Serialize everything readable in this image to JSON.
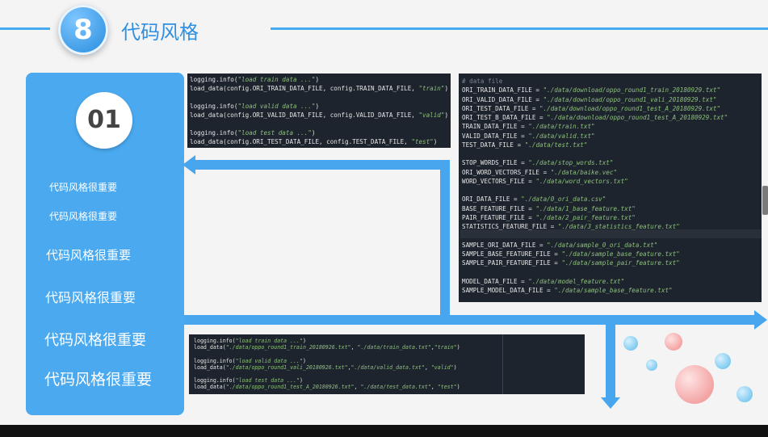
{
  "header": {
    "number": "8",
    "title": "代码风格"
  },
  "panel": {
    "badge": "01",
    "lines": [
      "代码风格很重要",
      "代码风格很重要",
      "代码风格很重要",
      "代码风格很重要",
      "代码风格很重要",
      "代码风格很重要"
    ]
  },
  "code_top": [
    "logging.info(\"load train data ...\")",
    "load_data(config.ORI_TRAIN_DATA_FILE, config.TRAIN_DATA_FILE, \"train\")",
    "",
    "logging.info(\"load valid data ...\")",
    "load_data(config.ORI_VALID_DATA_FILE, config.VALID_DATA_FILE, \"valid\")",
    "",
    "logging.info(\"load test data ...\")",
    "load_data(config.ORI_TEST_DATA_FILE, config.TEST_DATA_FILE, \"test\")"
  ],
  "code_right": [
    "# data file",
    "ORI_TRAIN_DATA_FILE = \"./data/download/oppo_round1_train_20180929.txt\"",
    "ORI_VALID_DATA_FILE = \"./data/download/oppo_round1_vali_20180929.txt\"",
    "ORI_TEST_DATA_FILE = \"./data/download/oppo_round1_test_A_20180929.txt\"",
    "ORI_TEST_B_DATA_FILE = \"./data/download/oppo_round1_test_A_20180929.txt\"",
    "TRAIN_DATA_FILE = \"./data/train.txt\"",
    "VALID_DATA_FILE = \"./data/valid.txt\"",
    "TEST_DATA_FILE = \"./data/test.txt\"",
    "",
    "STOP_WORDS_FILE = \"./data/stop_words.txt\"",
    "ORI_WORD_VECTORS_FILE = \"./data/baike.vec\"",
    "WORD_VECTORS_FILE = \"./data/word_vectors.txt\"",
    "",
    "ORI_DATA_FILE = \"./data/0_ori_data.csv\"",
    "BASE_FEATURE_FILE = \"./data/1_base_feature.txt\"",
    "PAIR_FEATURE_FILE = \"./data/2_pair_feature.txt\"",
    "STATISTICS_FEATURE_FILE = \"./data/3_statistics_feature.txt\"",
    "",
    "SAMPLE_ORI_DATA_FILE = \"./data/sample_0_ori_data.txt\"",
    "SAMPLE_BASE_FEATURE_FILE = \"./data/sample_base_feature.txt\"",
    "SAMPLE_PAIR_FEATURE_FILE = \"./data/sample_pair_feature.txt\"",
    "",
    "MODEL_DATA_FILE = \"./data/model_feature.txt\"",
    "SAMPLE_MODEL_DATA_FILE = \"./data/sample_base_feature.txt\""
  ],
  "code_bottom": [
    "logging.info(\"load train data ...\")",
    "load_data(\"./data/oppo_round1_train_20180926.txt\", \"./data/train_data.txt\",\"train\")",
    "",
    "logging.info(\"load valid data ...\")",
    "load_data(\"./data/oppo_round1_vali_20180926.txt\",\"./data/valid_data.txt\", \"valid\")",
    "",
    "logging.info(\"load test data ...\")",
    "load_data(\"./data/oppo_round1_test_A_20180926.txt\", \"./data/test_data.txt\", \"test\")"
  ],
  "colors": {
    "accent": "#47a6ee",
    "code_bg": "#1d242d",
    "string": "#8ec07c"
  }
}
